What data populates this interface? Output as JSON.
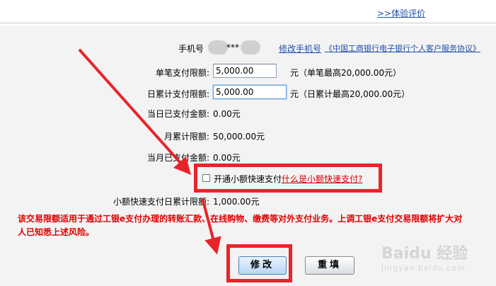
{
  "header": {
    "review_link": ">>体验评价"
  },
  "form": {
    "phone_label": "手机号",
    "phone_masked": "***",
    "change_phone_link": "修改手机号",
    "agreement_link": "《中国工商银行电子银行个人客户服务协议》",
    "single_limit_label": "单笔支付限额:",
    "single_limit_value": "5,000.00",
    "single_limit_note": "元（单笔最高20,000.00元）",
    "daily_limit_label": "日累计支付限额:",
    "daily_limit_value": "5,000.00",
    "daily_limit_note": "元（日累计最高20,000.00元）",
    "today_paid_label": "当日已支付金额:",
    "today_paid_value": "0.00元",
    "monthly_label": "月累计限额:",
    "monthly_value": "50,000.00元",
    "month_paid_label": "当月已支付金额:",
    "month_paid_value": "0.00元",
    "quickpay_checkbox_label": "开通小额快速支付",
    "quickpay_help_link": "什么是小额快速支付?",
    "quickpay_daily_label": "小额快速支付日累计限额:",
    "quickpay_daily_value": "1,000.00元"
  },
  "notice": {
    "line1": "该交易限额适用于通过工银e支付办理的转账汇款、在线购物、缴费等对外支付业务。上调工银e支付交易限额将扩大对",
    "line2": "人已知悉上述风险。"
  },
  "buttons": {
    "modify": "修改",
    "reset": "重填"
  },
  "watermark": {
    "brand": "Baidu 经验",
    "url": "jingyan.baidu.com"
  },
  "colors": {
    "link": "#1f4ea8",
    "warning": "#e00000",
    "highlight": "#e8242a"
  }
}
